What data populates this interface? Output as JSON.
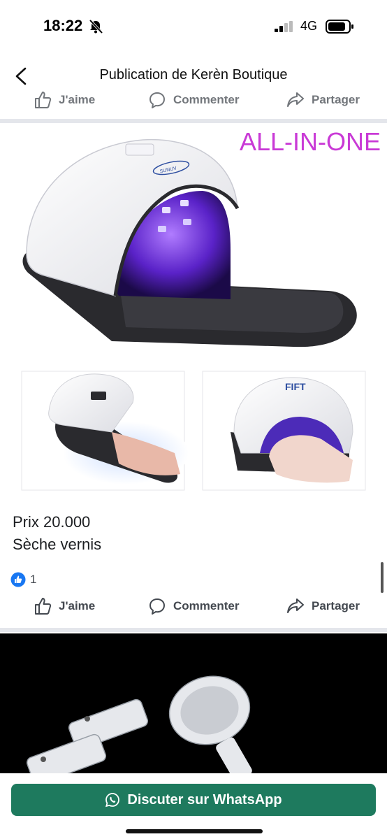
{
  "status_bar": {
    "time": "18:22",
    "network": "4G"
  },
  "header": {
    "title": "Publication de Kerèn Boutique"
  },
  "actions": {
    "like": "J'aime",
    "comment": "Commenter",
    "share": "Partager"
  },
  "image": {
    "banner_text": "ALL-IN-ONE",
    "brand_accent": "#c93ad6"
  },
  "post": {
    "price": "Prix 20.000",
    "description": "Sèche vernis",
    "like_count": "1"
  },
  "whatsapp": {
    "label": "Discuter sur WhatsApp",
    "color": "#1e7a5e"
  }
}
